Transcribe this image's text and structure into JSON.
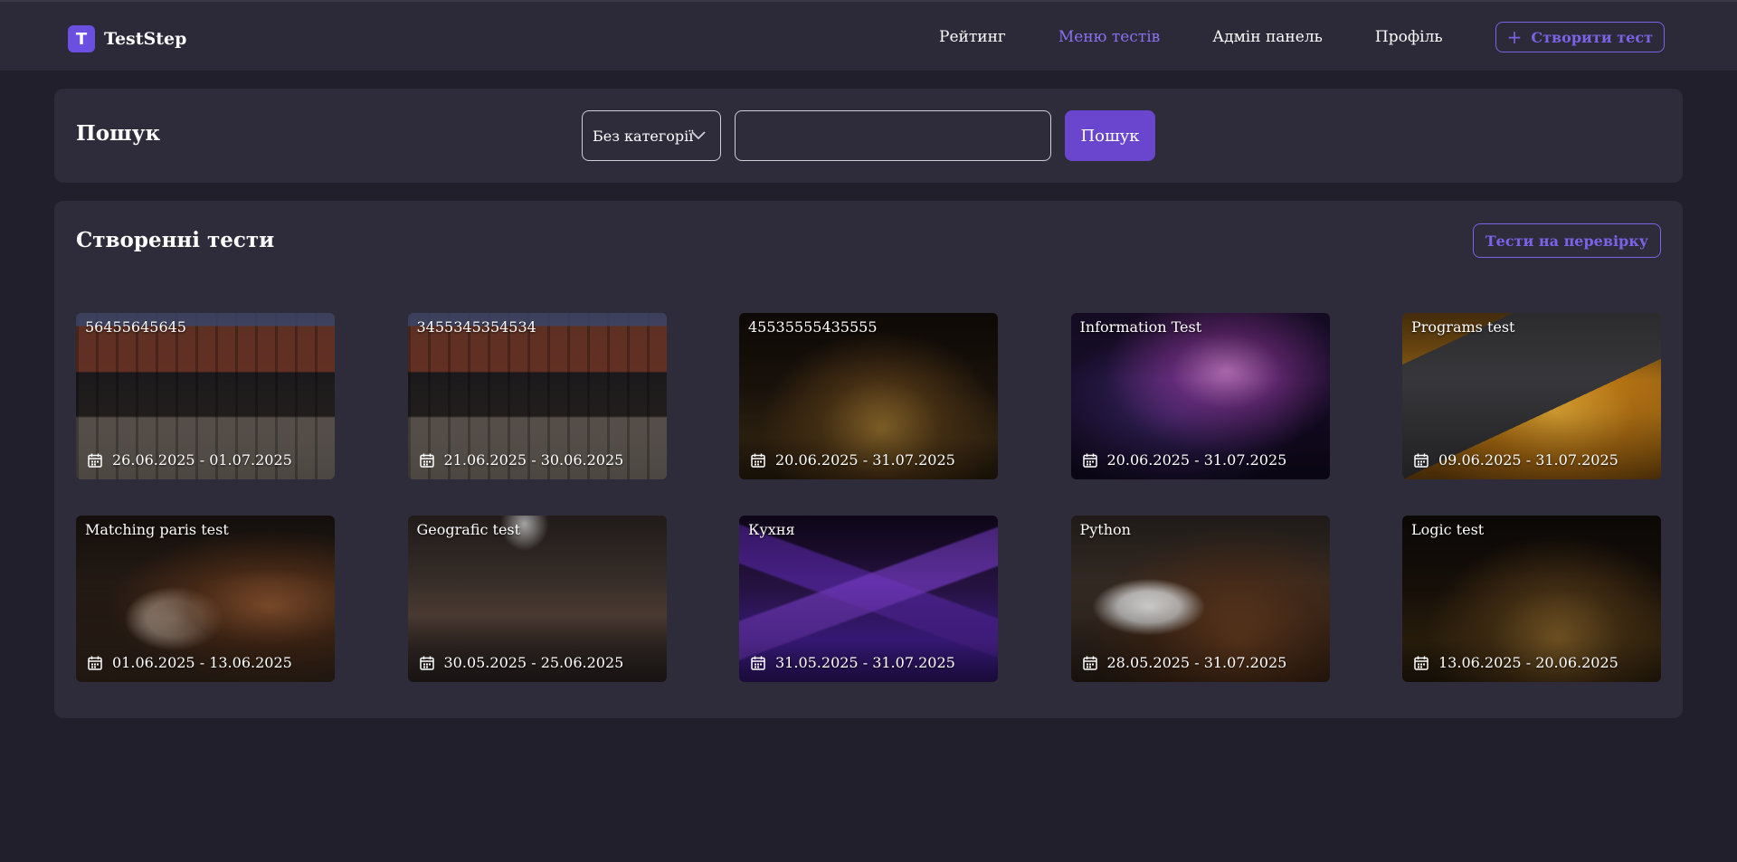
{
  "app": {
    "logo_letter": "T",
    "name": "TestStep"
  },
  "nav": {
    "items": [
      {
        "label": "Рейтинг"
      },
      {
        "label": "Меню тестів"
      },
      {
        "label": "Адмін панель"
      },
      {
        "label": "Профіль"
      }
    ],
    "create_label": "Створити тест",
    "active_index": 1
  },
  "search": {
    "title": "Пошук",
    "category_selected": "Без категорії",
    "query_value": "",
    "button_label": "Пошук"
  },
  "tests_section": {
    "title": "Створенні тести",
    "review_button_label": "Тести на перевірку",
    "cards": [
      {
        "title": "56455645645",
        "dates": "26.06.2025 - 01.07.2025",
        "image": "cafe-facade"
      },
      {
        "title": "3455345354534",
        "dates": "21.06.2025 - 30.06.2025",
        "image": "cafe-facade"
      },
      {
        "title": "45535555435555",
        "dates": "20.06.2025 - 31.07.2025",
        "image": "park-sunset"
      },
      {
        "title": "Information Test",
        "dates": "20.06.2025 - 31.07.2025",
        "image": "aurora"
      },
      {
        "title": "Programs test",
        "dates": "09.06.2025 - 31.07.2025",
        "image": "cpu-chip"
      },
      {
        "title": "Matching paris test",
        "dates": "01.06.2025 - 13.06.2025",
        "image": "coffee-cup"
      },
      {
        "title": "Geografic test",
        "dates": "30.05.2025 - 25.06.2025",
        "image": "cafe-bar"
      },
      {
        "title": "Кухня",
        "dates": "31.05.2025 - 31.07.2025",
        "image": "purple-mountains"
      },
      {
        "title": "Python",
        "dates": "28.05.2025 - 31.07.2025",
        "image": "coffee-beans"
      },
      {
        "title": "Logic test",
        "dates": "13.06.2025 - 20.06.2025",
        "image": "park-sunset"
      }
    ]
  },
  "colors": {
    "accent": "#7a63e6",
    "button_fill": "#6a46cf",
    "background": "#221f2c",
    "panel": "#2e2b3a",
    "header": "#2c2938"
  },
  "icons": {
    "plus": "plus-icon",
    "chevron": "chevron-down-icon",
    "calendar": "calendar-icon"
  }
}
